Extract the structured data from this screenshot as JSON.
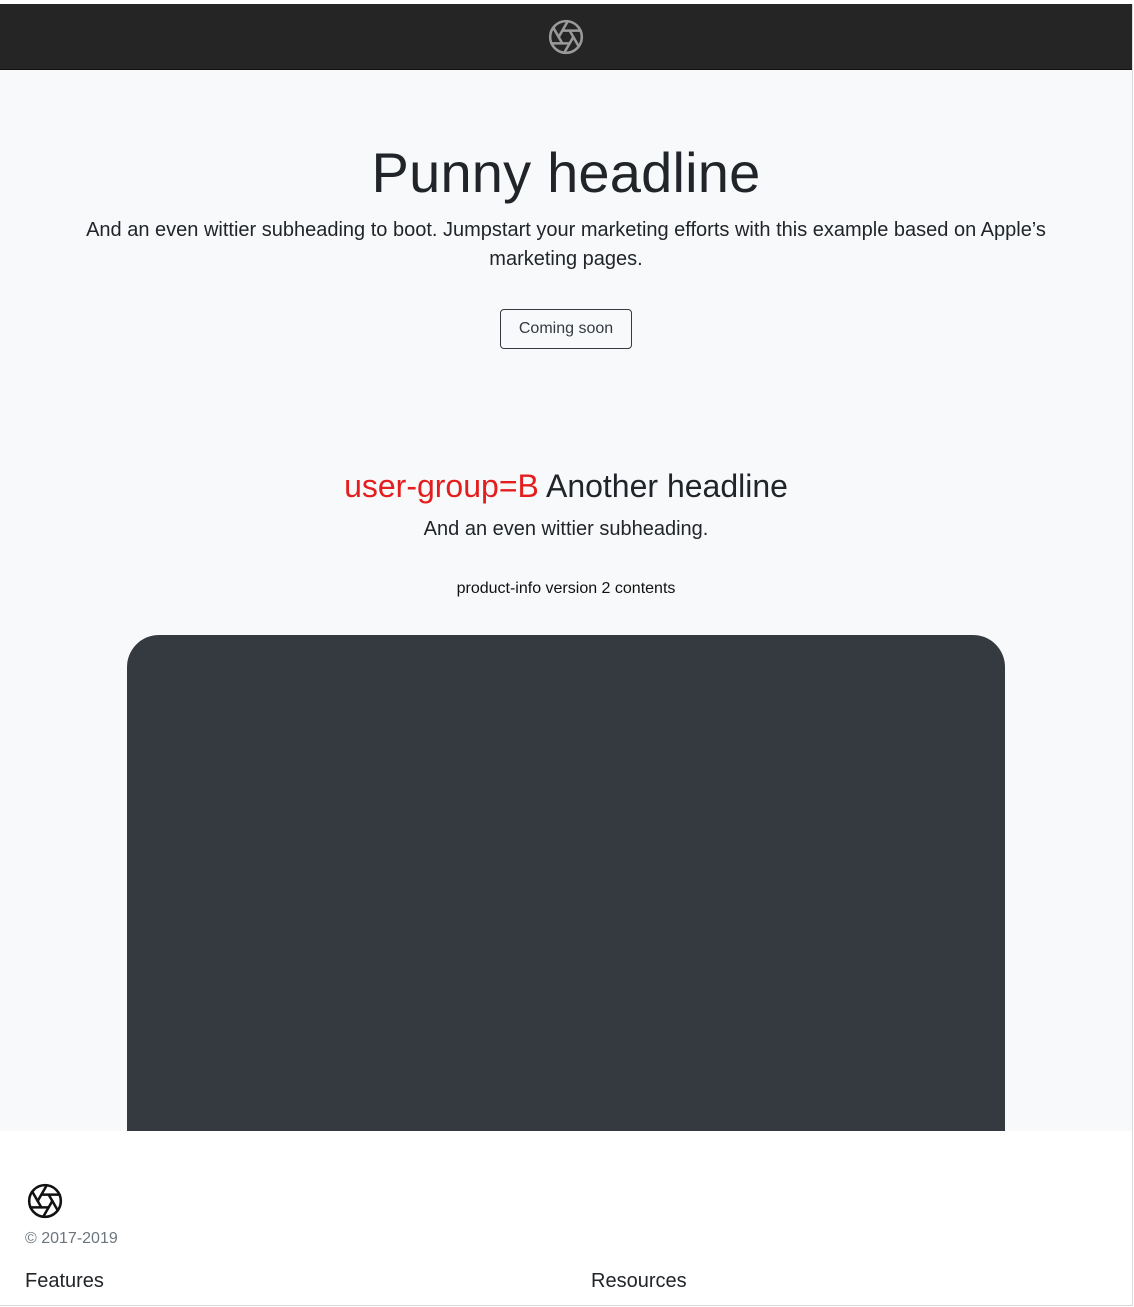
{
  "navbar": {
    "logo_icon": "aperture-icon"
  },
  "hero": {
    "title": "Punny headline",
    "subtitle": "And an even wittier subheading to boot. Jumpstart your marketing efforts with this example based on Apple’s marketing pages.",
    "button_label": "Coming soon"
  },
  "section": {
    "group_tag": "user-group=B",
    "title": "Another headline",
    "subtitle": "And an even wittier subheading.",
    "product_info": "product-info version 2 contents"
  },
  "footer": {
    "logo_icon": "aperture-icon",
    "copyright": "© 2017-2019",
    "columns": [
      {
        "title": "Features"
      },
      {
        "title": "Resources"
      }
    ]
  },
  "colors": {
    "navbar_bg": "#252525",
    "hero_bg": "#f8f9fa",
    "device_panel": "#343a40",
    "group_tag": "#e41e1e"
  }
}
